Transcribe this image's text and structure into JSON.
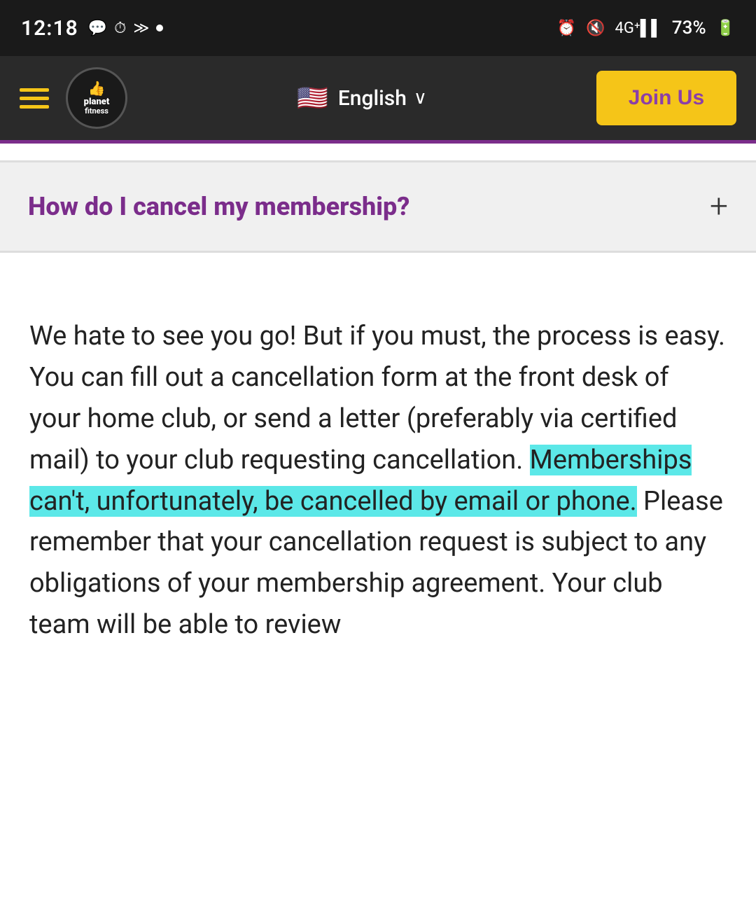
{
  "status_bar": {
    "time": "12:18",
    "icons": [
      "💬",
      "⏱",
      "≫",
      "•"
    ],
    "right_icons": [
      "⏰",
      "🔇",
      "4GE"
    ],
    "battery": "73%"
  },
  "nav": {
    "language": "English",
    "join_button": "Join Us",
    "logo_planet": "planet",
    "logo_fitness": "fitness"
  },
  "faq": {
    "question": "How do I cancel my membership?",
    "toggle_icon": "+"
  },
  "content": {
    "paragraph_before": "We hate to see you go! But if you must, the process is easy. You can fill out a cancellation form at the front desk of your home club, or send a letter (preferably via certified mail) to your club requesting cancellation. ",
    "highlighted_text": "Memberships can't, unfortunately, be cancelled by email or phone.",
    "paragraph_after": " Please remember that your cancellation request is subject to any obligations of your membership agreement. Your club team will be able to review"
  },
  "colors": {
    "purple": "#7b2d8b",
    "yellow": "#f5c518",
    "highlight": "#5ce8e8",
    "dark_bg": "#2a2a2a",
    "status_bg": "#1a1a1a"
  }
}
